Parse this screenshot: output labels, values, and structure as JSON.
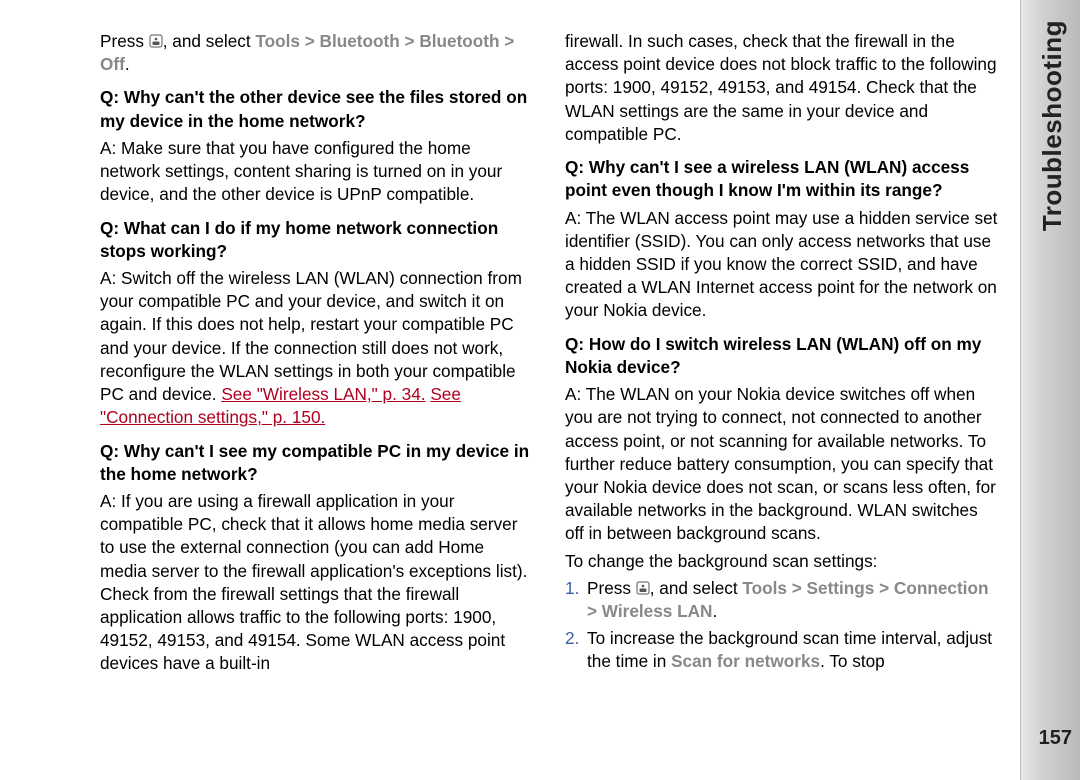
{
  "sidebar": {
    "title": "Troubleshooting",
    "page_number": "157"
  },
  "left": {
    "p1_a": "Press ",
    "p1_b": ", and select ",
    "p1_path": "Tools  >  Bluetooth  >  Bluetooth  >  Off",
    "p1_c": ".",
    "q1": "Q: Why can't the other device see the files stored on my device in the home network?",
    "a1": "A: Make sure that you have configured the home network settings, content sharing is turned on in your device, and the other device is UPnP compatible.",
    "q2": "Q: What can I do if my home network connection stops working?",
    "a2_a": "A: Switch off the wireless LAN (WLAN) connection from your compatible PC and your device, and switch it on again. If this does not help, restart your compatible PC and your device. If the connection still does not work, reconfigure the WLAN settings in both your compatible PC and device. ",
    "a2_link1": "See \"Wireless LAN,\" p. 34.",
    "a2_sp": " ",
    "a2_link2": "See \"Connection settings,\" p. 150.",
    "q3": "Q: Why can't I see my compatible PC in my device in the home network?",
    "a3": "A: If you are using a firewall application in your compatible PC, check that it allows home media server to use the external connection (you can add Home media server to the firewall application's exceptions list). Check from the firewall settings that the firewall application allows traffic to the following ports: 1900, 49152, 49153, and 49154. Some WLAN access point devices have a built-in"
  },
  "right": {
    "p1": "firewall. In such cases, check that the firewall in the access point device does not block traffic to the following ports: 1900, 49152, 49153, and 49154. Check that the WLAN settings are the same in your device and compatible PC.",
    "q1": "Q: Why can't I see a wireless LAN (WLAN) access point even though I know I'm within its range?",
    "a1": "A: The WLAN access point may use a hidden service set identifier (SSID). You can only access networks that use a hidden SSID if you know the correct SSID, and have created a WLAN Internet access point for the network on your Nokia device.",
    "q2": "Q: How do I switch wireless LAN (WLAN) off on my Nokia device?",
    "a2": "A: The WLAN on your Nokia device switches off when you are not trying to connect, not connected to another access point, or not scanning for available networks. To further reduce battery consumption, you can specify that your Nokia device does not scan, or scans less often, for available networks in the background. WLAN switches off in between background scans.",
    "p2": "To change the background scan settings:",
    "li1_a": "Press ",
    "li1_b": ", and select ",
    "li1_path": "Tools  >  Settings  >  Connection  >  Wireless LAN",
    "li1_c": ".",
    "li2_a": "To increase the background scan time interval, adjust the time in ",
    "li2_scan": "Scan for networks",
    "li2_b": ". To stop"
  }
}
